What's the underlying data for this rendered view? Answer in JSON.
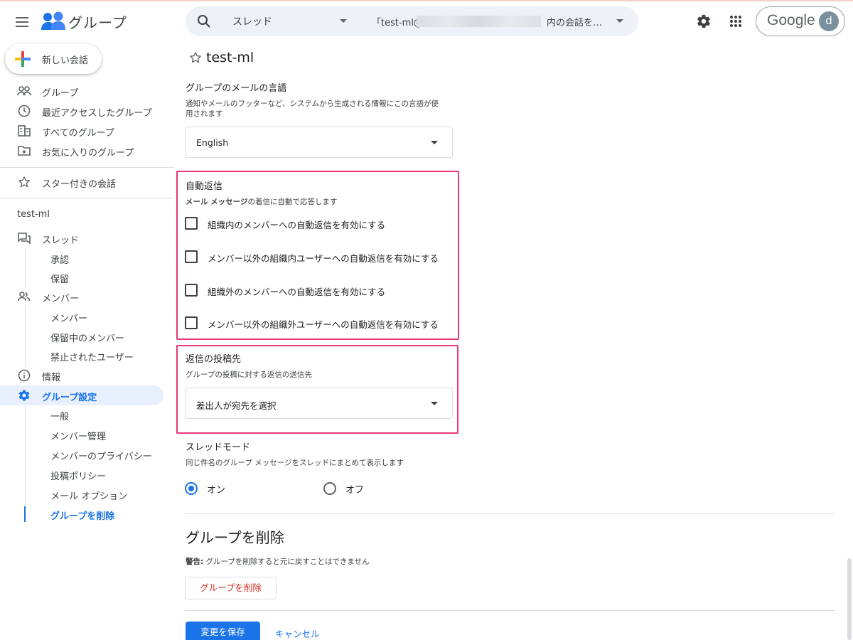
{
  "header": {
    "app_title": "グループ",
    "search_scope": "スレッド",
    "search_query_prefix": "「test-ml@",
    "search_query_suffix": "内の会話を…",
    "google_label": "Google",
    "avatar_initial": "d"
  },
  "sidebar": {
    "new_chat": "新しい会話",
    "top_items": [
      {
        "label": "グループ",
        "icon": "groups-icon"
      },
      {
        "label": "最近アクセスしたグループ",
        "icon": "clock-icon"
      },
      {
        "label": "すべてのグループ",
        "icon": "building-icon"
      },
      {
        "label": "お気に入りのグループ",
        "icon": "folder-star-icon"
      }
    ],
    "starred": "スター付きの会話",
    "group_name": "test-ml",
    "threads": "スレッド",
    "approve": "承認",
    "pending": "保留",
    "members": "メンバー",
    "members_sub": "メンバー",
    "pending_members": "保留中のメンバー",
    "banned_users": "禁止されたユーザー",
    "info": "情報",
    "group_settings": "グループ設定",
    "general": "一般",
    "member_management": "メンバー管理",
    "member_privacy": "メンバーのプライバシー",
    "posting_policy": "投稿ポリシー",
    "email_options": "メール オプション",
    "delete_group": "グループを削除"
  },
  "main": {
    "page_title": "test-ml",
    "language": {
      "title": "グループのメールの言語",
      "desc_line1": "通知やメールのフッターなど、システムから生成される情報にこの言語が使",
      "desc_line2": "用されます",
      "value": "English"
    },
    "auto_reply": {
      "title": "自動返信",
      "desc_bold": "メール メッセージ",
      "desc_rest": "の着信に自動で応答します",
      "options": [
        "組織内のメンバーへの自動返信を有効にする",
        "メンバー以外の組織内ユーザーへの自動返信を有効にする",
        "組織外のメンバーへの自動返信を有効にする",
        "メンバー以外の組織外ユーザーへの自動返信を有効にする"
      ]
    },
    "reply_to": {
      "title": "返信の投稿先",
      "desc": "グループの投稿に対する返信の送信先",
      "value": "差出人が宛先を選択"
    },
    "thread_mode": {
      "title": "スレッドモード",
      "desc": "同じ件名のグループ メッセージをスレッドにまとめて表示します",
      "on": "オン",
      "off": "オフ",
      "selected": "on"
    },
    "delete": {
      "title": "グループを削除",
      "warning_label": "警告:",
      "warning_text": " グループを削除すると元に戻すことはできません",
      "button": "グループを削除"
    },
    "save": "変更を保存",
    "cancel": "キャンセル"
  },
  "colors": {
    "accent": "#1a73e8",
    "highlight": "#e8387a",
    "danger": "#d93025"
  }
}
